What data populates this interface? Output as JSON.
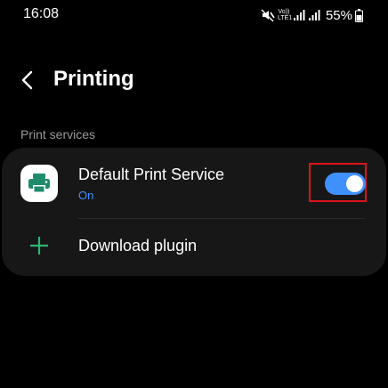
{
  "status_bar": {
    "time": "16:08",
    "volte_line1": "Vo))",
    "volte_line2": "LTE1",
    "battery_percent": "55%",
    "icons": [
      "mute-icon",
      "volte-icon",
      "signal-icon",
      "signal-icon-2",
      "battery-icon"
    ]
  },
  "header": {
    "back_icon": "chevron-left-icon",
    "title": "Printing"
  },
  "section": {
    "label": "Print services"
  },
  "services": {
    "default": {
      "icon": "printer-icon",
      "title": "Default Print Service",
      "status": "On",
      "toggle_on": true
    },
    "download": {
      "icon": "plus-icon",
      "label": "Download plugin"
    }
  },
  "colors": {
    "background": "#000000",
    "card": "#171717",
    "accent_blue": "#3e91ff",
    "printer_green": "#1f8a6c",
    "plus_green": "#2bb673",
    "highlight_red": "#e0121b",
    "section_label": "#9a9a9a"
  }
}
